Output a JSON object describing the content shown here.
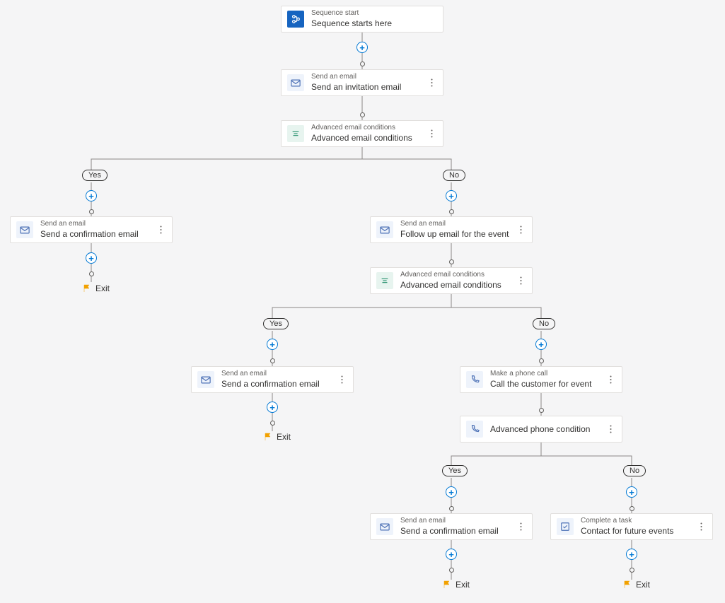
{
  "labels": {
    "yes": "Yes",
    "no": "No",
    "exit": "Exit"
  },
  "nodes": {
    "start": {
      "t1": "Sequence start",
      "t2": "Sequence starts here"
    },
    "invite": {
      "t1": "Send an email",
      "t2": "Send an invitation email"
    },
    "cond1": {
      "t1": "Advanced email conditions",
      "t2": "Advanced email conditions"
    },
    "confirm1": {
      "t1": "Send an email",
      "t2": "Send a confirmation email"
    },
    "followup": {
      "t1": "Send an email",
      "t2": "Follow up email for the event"
    },
    "cond2": {
      "t1": "Advanced email conditions",
      "t2": "Advanced email conditions"
    },
    "confirm2": {
      "t1": "Send an email",
      "t2": "Send a confirmation email"
    },
    "call": {
      "t1": "Make a phone call",
      "t2": "Call the customer for event"
    },
    "phonecond": {
      "t1": "",
      "t2": "Advanced phone condition"
    },
    "confirm3": {
      "t1": "Send an email",
      "t2": "Send a confirmation email"
    },
    "task": {
      "t1": "Complete a task",
      "t2": "Contact for future events"
    }
  }
}
